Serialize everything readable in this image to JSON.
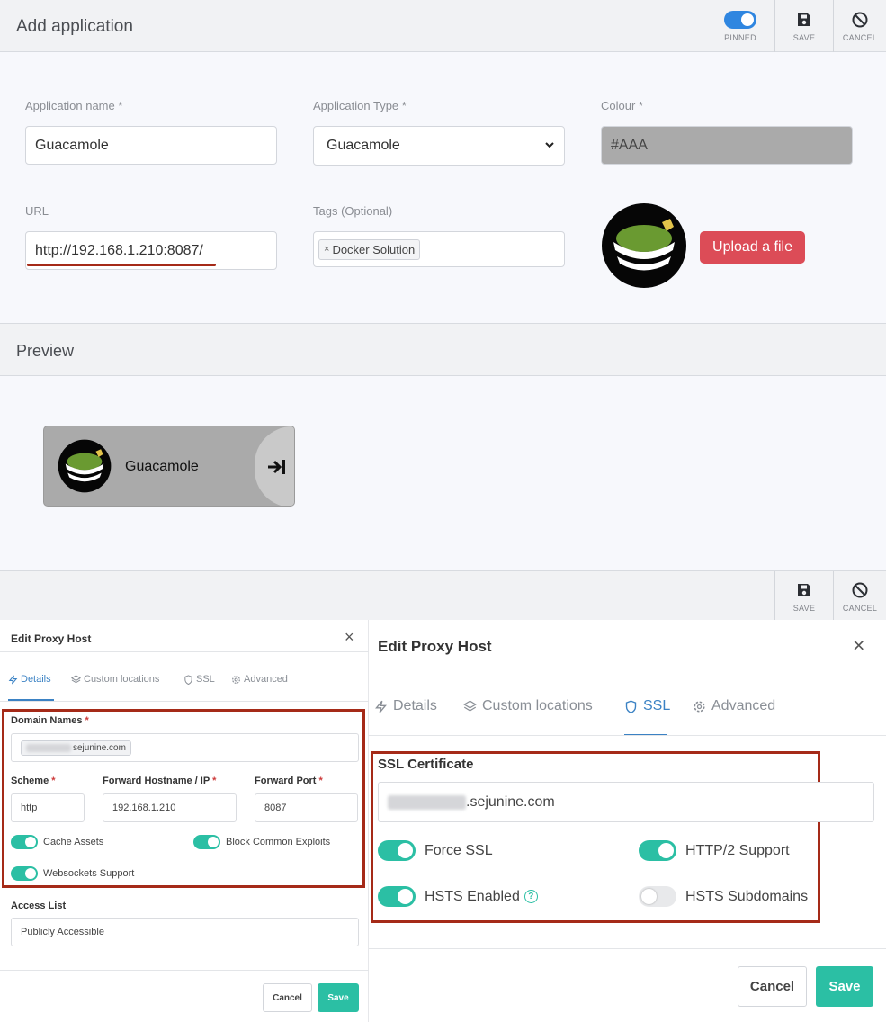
{
  "header": {
    "title": "Add application",
    "pinned_label": "PINNED",
    "save_label": "SAVE",
    "cancel_label": "CANCEL"
  },
  "form": {
    "name": {
      "label": "Application name *",
      "value": "Guacamole"
    },
    "type": {
      "label": "Application Type *",
      "value": "Guacamole"
    },
    "colour": {
      "label": "Colour *",
      "value": "#AAA"
    },
    "url": {
      "label": "URL",
      "value": "http://192.168.1.210:8087/"
    },
    "tags": {
      "label": "Tags (Optional)",
      "tag_remove": "×",
      "tag_value": "Docker Solution"
    },
    "upload_label": "Upload a file"
  },
  "preview": {
    "title": "Preview",
    "tile_name": "Guacamole"
  },
  "footer": {
    "save_label": "SAVE",
    "cancel_label": "CANCEL"
  },
  "proxy_left": {
    "title": "Edit Proxy Host",
    "close": "×",
    "tabs": [
      {
        "label": "Details",
        "icon": "bolt-icon"
      },
      {
        "label": "Custom locations",
        "icon": "layers-icon"
      },
      {
        "label": "SSL",
        "icon": "shield-icon"
      },
      {
        "label": "Advanced",
        "icon": "gear-icon"
      }
    ],
    "domain_names_label": "Domain Names",
    "domain_value": "sejunine.com",
    "scheme_label": "Scheme",
    "scheme_value": "http",
    "hostname_label": "Forward Hostname / IP",
    "hostname_value": "192.168.1.210",
    "port_label": "Forward Port",
    "port_value": "8087",
    "cache_assets": "Cache Assets",
    "block_exploits": "Block Common Exploits",
    "websockets": "Websockets Support",
    "access_list_label": "Access List",
    "access_list_value": "Publicly Accessible",
    "cancel_label": "Cancel",
    "save_label": "Save",
    "required_mark": "*"
  },
  "proxy_right": {
    "title": "Edit Proxy Host",
    "close": "×",
    "tabs": [
      {
        "label": "Details",
        "icon": "bolt-icon"
      },
      {
        "label": "Custom locations",
        "icon": "layers-icon"
      },
      {
        "label": "SSL",
        "icon": "shield-icon"
      },
      {
        "label": "Advanced",
        "icon": "gear-icon"
      }
    ],
    "active_tab": "SSL",
    "ssl_cert_label": "SSL Certificate",
    "ssl_cert_value": ".sejunine.com",
    "force_ssl": "Force SSL",
    "http2": "HTTP/2 Support",
    "hsts_enabled": "HSTS Enabled",
    "hsts_help": "?",
    "hsts_subdomains": "HSTS Subdomains",
    "cancel_label": "Cancel",
    "save_label": "Save"
  },
  "colors": {
    "accent_blue": "#2f86e0",
    "upload_red": "#dc4c57",
    "teal": "#2bbfa4",
    "annotation_red": "#a52a18",
    "tile_color": "#AAAAAA"
  }
}
